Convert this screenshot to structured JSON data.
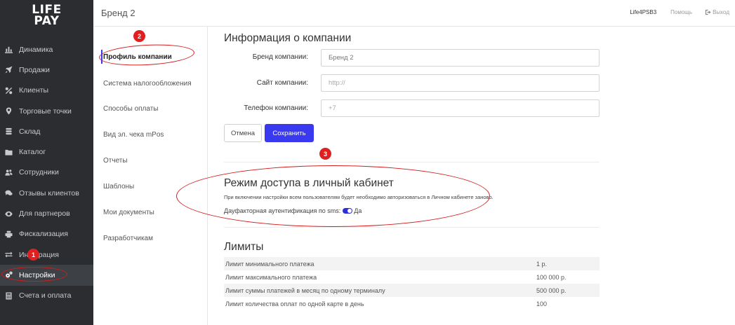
{
  "logo": {
    "line1": "LIFE",
    "line2": "PAY"
  },
  "sidebar": {
    "items": [
      {
        "label": "Динамика",
        "icon": "bar-chart-icon"
      },
      {
        "label": "Продажи",
        "icon": "rocket-icon"
      },
      {
        "label": "Клиенты",
        "icon": "percent-icon"
      },
      {
        "label": "Торговые точки",
        "icon": "map-marker-icon"
      },
      {
        "label": "Склад",
        "icon": "database-icon"
      },
      {
        "label": "Каталог",
        "icon": "folder-icon"
      },
      {
        "label": "Сотрудники",
        "icon": "users-icon"
      },
      {
        "label": "Отзывы клиентов",
        "icon": "comments-icon"
      },
      {
        "label": "Для партнеров",
        "icon": "eye-icon"
      },
      {
        "label": "Фискализация",
        "icon": "printer-icon"
      },
      {
        "label": "Интеграция",
        "icon": "exchange-icon"
      },
      {
        "label": "Настройки",
        "icon": "cogs-icon"
      },
      {
        "label": "Счета и оплата",
        "icon": "calculator-icon"
      }
    ],
    "active_index": 11
  },
  "header": {
    "title": "Бренд 2",
    "user": "Life4PSB3",
    "help": "Помощь",
    "exit": "Выход"
  },
  "submenu": {
    "items": [
      "Профиль компании",
      "Система налогообложения",
      "Способы оплаты",
      "Вид эл. чека mPos",
      "Отчеты",
      "Шаблоны",
      "Мои документы",
      "Разработчикам"
    ]
  },
  "company": {
    "title": "Информация о компании",
    "brand_label": "Бренд компании:",
    "brand_value": "Бренд 2",
    "site_label": "Сайт компании:",
    "site_placeholder": "http://",
    "phone_label": "Телефон компании:",
    "phone_placeholder": "+7",
    "cancel": "Отмена",
    "save": "Сохранить"
  },
  "access": {
    "title": "Режим доступа в личный кабинет",
    "note": "При включении настройки всем пользователям будет необходимо авторизоваться в Личном кабинете заново.",
    "twofa_label": "Дауфакторная аутентификация по sms:",
    "twofa_value": "Да",
    "twofa_enabled": true
  },
  "limits": {
    "title": "Лимиты",
    "rows": [
      {
        "name": "Лимит минимального платежа",
        "value": "1 р."
      },
      {
        "name": "Лимит максимального платежа",
        "value": "100 000 р."
      },
      {
        "name": "Лимит суммы платежей в месяц по одному терминалу",
        "value": "500 000 р."
      },
      {
        "name": "Лимит количества оплат по одной карте в день",
        "value": "100"
      }
    ]
  },
  "annotations": {
    "badge1": "1",
    "badge2": "2",
    "badge3": "3",
    "color": "#e02020"
  }
}
